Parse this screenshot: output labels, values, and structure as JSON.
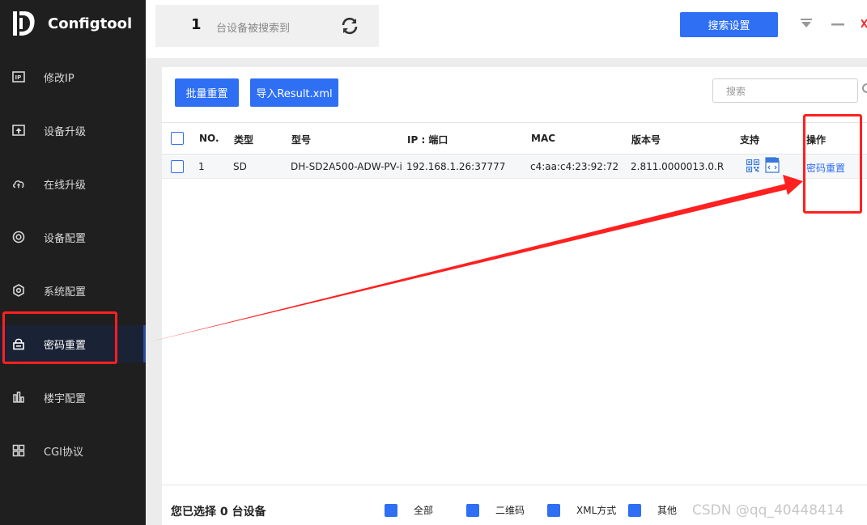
{
  "app": {
    "title": "Configtool"
  },
  "sidebar": {
    "items": [
      {
        "label": "修改IP",
        "icon": "ip-icon"
      },
      {
        "label": "设备升级",
        "icon": "upload-icon"
      },
      {
        "label": "在线升级",
        "icon": "cloud-upload-icon"
      },
      {
        "label": "设备配置",
        "icon": "target-icon"
      },
      {
        "label": "系统配置",
        "icon": "hexagon-gear-icon"
      },
      {
        "label": "密码重置",
        "icon": "lock-icon",
        "active": true
      },
      {
        "label": "楼宇配置",
        "icon": "building-chart-icon"
      },
      {
        "label": "CGI协议",
        "icon": "grid-icon"
      }
    ]
  },
  "topbar": {
    "device_count": "1",
    "device_count_text": "台设备被搜索到",
    "search_settings_label": "搜索设置"
  },
  "toolbar": {
    "batch_reset_label": "批量重置",
    "import_label": "导入Result.xml",
    "search_placeholder": "搜索"
  },
  "table": {
    "headers": {
      "no": "NO.",
      "type": "类型",
      "model": "型号",
      "ip": "IP : 端口",
      "mac": "MAC",
      "version": "版本号",
      "support": "支持",
      "action": "操作"
    },
    "rows": [
      {
        "no": "1",
        "type": "SD",
        "model": "DH-SD2A500-ADW-PV-i",
        "ip": "192.168.1.26:37777",
        "mac": "c4:aa:c4:23:92:72",
        "version": "2.811.0000013.0.R",
        "action": "密码重置"
      }
    ]
  },
  "footer": {
    "selected_text": "您已选择 0 台设备",
    "filters": [
      {
        "label": "全部",
        "checked": true
      },
      {
        "label": "二维码",
        "checked": true
      },
      {
        "label": "XML方式",
        "checked": true
      },
      {
        "label": "其他",
        "checked": true
      }
    ]
  },
  "watermark": "CSDN @qq_40448414",
  "colors": {
    "accent": "#2e6ff4",
    "sidebar_bg": "#1f1f1f",
    "annotation": "#ff2020"
  }
}
